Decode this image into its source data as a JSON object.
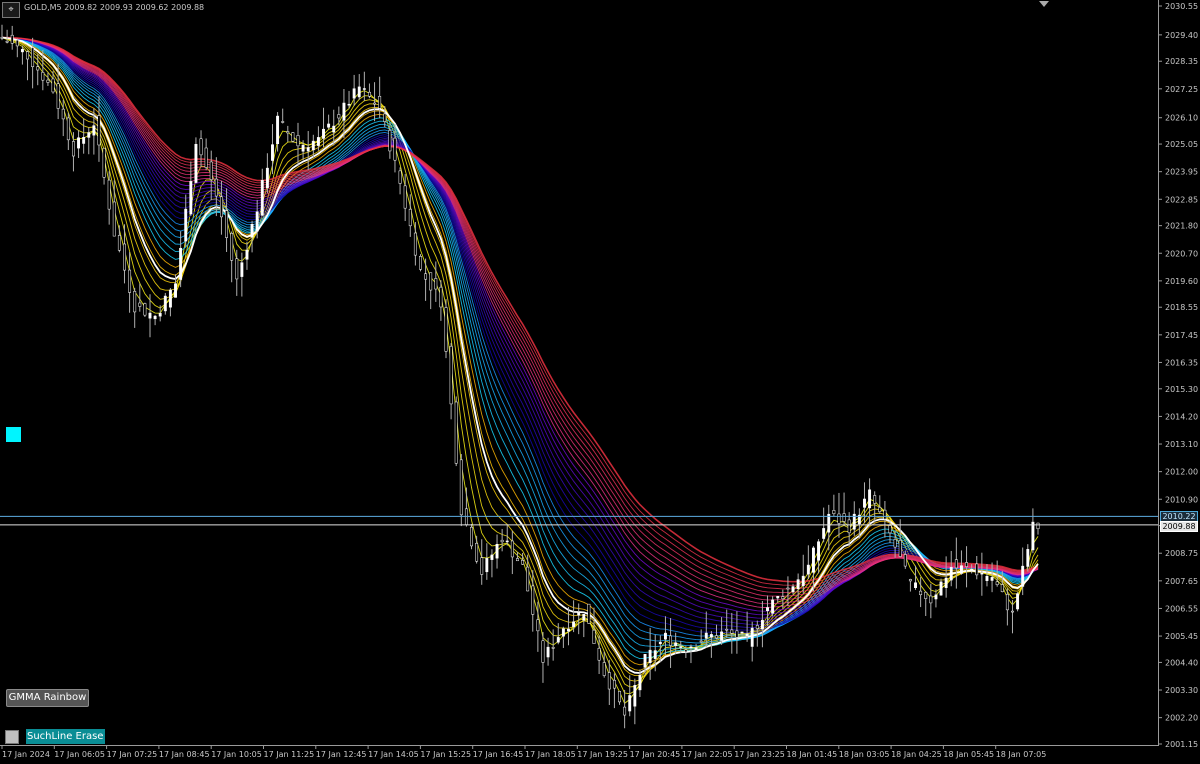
{
  "header": {
    "symbol_line": "GOLD,M5  2009.82 2009.93 2009.62 2009.88",
    "corner_icon": "chart-menu-icon"
  },
  "buttons": {
    "gmma_label": "GMMA Rainbow",
    "suchline_label": "SuchLine Erase"
  },
  "colors": {
    "background": "#000000",
    "candle_body": "#ffffff",
    "candle_wick": "#b0b0b0",
    "h_line_1": "#5dade2",
    "h_line_2": "#e0e0e0",
    "cyan_box": "#00f5ff",
    "rainbow_fast": [
      "#ffff00",
      "#e8e800",
      "#c8c800",
      "#00c8ff",
      "#00a0ff"
    ],
    "rainbow_slow": [
      "#0000a0",
      "#1a1aa0",
      "#4a2a8a",
      "#8a2a6a",
      "#c0303a",
      "#e07050"
    ]
  },
  "chart_data": {
    "type": "candlestick",
    "instrument": "GOLD,M5",
    "ohlc_shown": {
      "open": 2009.82,
      "high": 2009.93,
      "low": 2009.62,
      "close": 2009.88
    },
    "y_ticks": [
      "2030.55",
      "2029.40",
      "2028.35",
      "2027.25",
      "2026.10",
      "2025.05",
      "2023.95",
      "2022.85",
      "2021.80",
      "2020.70",
      "2019.60",
      "2018.55",
      "2017.45",
      "2016.35",
      "2015.30",
      "2014.20",
      "2013.10",
      "2012.00",
      "2010.90",
      "2009.85",
      "2008.75",
      "2007.65",
      "2006.55",
      "2005.45",
      "2004.40",
      "2003.30",
      "2002.20",
      "2001.15"
    ],
    "ylim": [
      2001.15,
      2030.55
    ],
    "x_ticks": [
      "17 Jan 2024",
      "17 Jan 06:05",
      "17 Jan 07:25",
      "17 Jan 08:45",
      "17 Jan 10:05",
      "17 Jan 11:25",
      "17 Jan 12:45",
      "17 Jan 14:05",
      "17 Jan 15:25",
      "17 Jan 16:45",
      "17 Jan 18:05",
      "17 Jan 19:25",
      "17 Jan 20:45",
      "17 Jan 22:05",
      "17 Jan 23:25",
      "18 Jan 01:45",
      "18 Jan 03:05",
      "18 Jan 04:25",
      "18 Jan 05:45",
      "18 Jan 07:05"
    ],
    "price_labels": {
      "line1": "2010.22",
      "line2": "2009.88"
    },
    "close_path": [
      [
        0,
        2029.3
      ],
      [
        5,
        2028.6
      ],
      [
        10,
        2027.2
      ],
      [
        14,
        2024.8
      ],
      [
        18,
        2025.9
      ],
      [
        22,
        2021.5
      ],
      [
        26,
        2018.6
      ],
      [
        30,
        2018.2
      ],
      [
        34,
        2019.5
      ],
      [
        38,
        2025.2
      ],
      [
        42,
        2023.0
      ],
      [
        46,
        2019.6
      ],
      [
        50,
        2022.5
      ],
      [
        54,
        2026.0
      ],
      [
        58,
        2025.0
      ],
      [
        62,
        2025.2
      ],
      [
        66,
        2026.2
      ],
      [
        70,
        2027.3
      ],
      [
        74,
        2026.5
      ],
      [
        78,
        2023.5
      ],
      [
        82,
        2020.0
      ],
      [
        86,
        2018.8
      ],
      [
        90,
        2010.5
      ],
      [
        94,
        2008.0
      ],
      [
        98,
        2009.4
      ],
      [
        102,
        2008.2
      ],
      [
        106,
        2004.5
      ],
      [
        110,
        2005.8
      ],
      [
        114,
        2006.5
      ],
      [
        118,
        2004.0
      ],
      [
        122,
        2002.3
      ],
      [
        126,
        2004.5
      ],
      [
        130,
        2005.4
      ],
      [
        134,
        2005.0
      ],
      [
        138,
        2005.4
      ],
      [
        142,
        2005.6
      ],
      [
        146,
        2005.3
      ],
      [
        150,
        2006.6
      ],
      [
        154,
        2007.3
      ],
      [
        158,
        2008.2
      ],
      [
        162,
        2010.3
      ],
      [
        166,
        2009.8
      ],
      [
        170,
        2011.1
      ],
      [
        174,
        2009.5
      ],
      [
        178,
        2007.5
      ],
      [
        182,
        2006.9
      ],
      [
        186,
        2008.2
      ],
      [
        190,
        2008.1
      ],
      [
        194,
        2007.8
      ],
      [
        198,
        2006.3
      ],
      [
        202,
        2009.8
      ]
    ],
    "series": [
      {
        "name": "GMMA Rainbow",
        "values": []
      }
    ]
  }
}
